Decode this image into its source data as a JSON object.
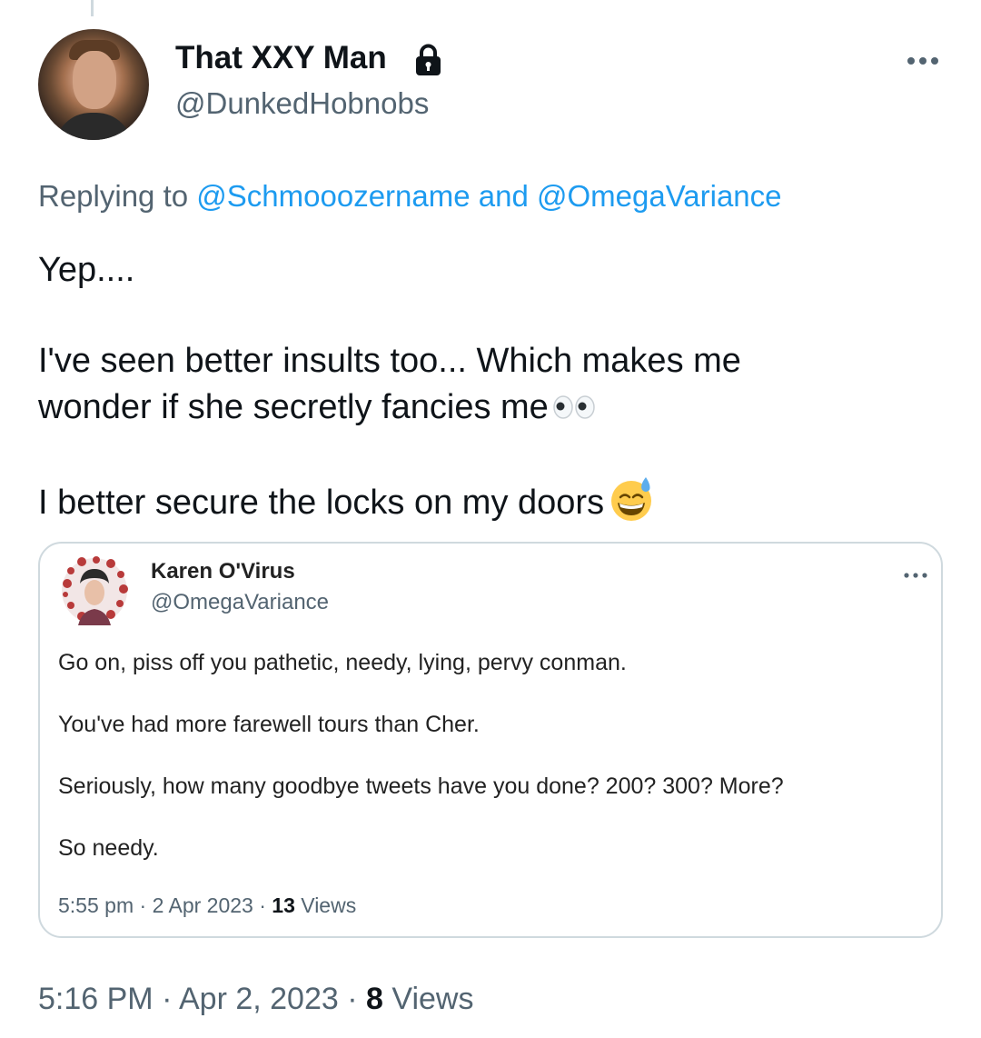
{
  "tweet": {
    "author": {
      "display_name": "That XXY Man",
      "handle": "@DunkedHobnobs",
      "protected_icon": "lock-icon"
    },
    "replying_to": {
      "prefix": "Replying to",
      "mentions": [
        "@Schmooozername",
        "@OmegaVariance"
      ],
      "joiner": "and"
    },
    "text": {
      "line1": "Yep....",
      "line2a": "I've seen better insults too... Which makes me",
      "line2b": "wonder if she secretly fancies me",
      "line3": "I better secure the locks on my doors"
    },
    "emojis": [
      "eyes-emoji",
      "grinning-face-with-sweat-emoji"
    ],
    "time": "5:16 PM",
    "date": "Apr 2, 2023",
    "views_count": "8",
    "views_label": "Views",
    "separator": "·"
  },
  "quote": {
    "author": {
      "display_name": "Karen O'Virus",
      "handle": "@OmegaVariance"
    },
    "paragraphs": [
      "Go on, piss off you pathetic, needy, lying, pervy conman.",
      "You've had more farewell tours than Cher.",
      "Seriously,  how many goodbye tweets have you done? 200? 300? More?",
      "So needy."
    ],
    "time": "5:55 pm",
    "date": "2 Apr 2023",
    "views_count": "13",
    "views_label": "Views",
    "separator": "·"
  },
  "colors": {
    "link": "#1d9bf0",
    "secondary_text": "#536471",
    "border": "#cfd9de"
  }
}
